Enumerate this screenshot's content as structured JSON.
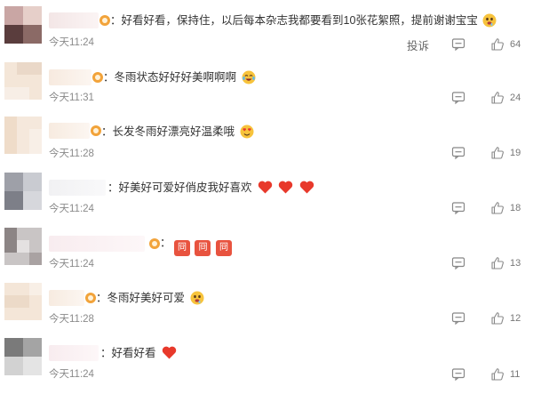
{
  "comments": [
    {
      "text": "：好看好看，保持住，以后每本杂志我都要看到10张花絮照，提前谢谢宝宝",
      "time": "今天11:24",
      "report": "投诉",
      "likes": "64",
      "icons": [
        "vip-badge-icon",
        "drooling-face-icon"
      ]
    },
    {
      "text": "：冬雨状态好好好美啊啊啊",
      "time": "今天11:31",
      "likes": "24",
      "icons": [
        "vip-badge-icon",
        "crying-laughing-face-icon"
      ]
    },
    {
      "text": "：长发冬雨好漂亮好温柔哦",
      "time": "今天11:28",
      "likes": "19",
      "icons": [
        "vip-badge-icon",
        "heart-eyes-face-icon"
      ]
    },
    {
      "text": "：好美好可爱好俏皮我好喜欢",
      "time": "今天11:24",
      "likes": "18",
      "icons": [
        "red-heart-icon",
        "red-heart-icon",
        "red-heart-icon"
      ]
    },
    {
      "text": "：",
      "stamps": [
        "冏",
        "冏",
        "冏"
      ],
      "time": "今天11:24",
      "likes": "13",
      "icons": [
        "vip-badge-icon",
        "sticker-icon"
      ]
    },
    {
      "text": "：冬雨好美好可爱",
      "time": "今天11:28",
      "likes": "12",
      "icons": [
        "vip-badge-icon",
        "drooling-face-icon"
      ]
    },
    {
      "text": "：好看好看",
      "time": "今天11:24",
      "likes": "11",
      "icons": [
        "red-heart-icon"
      ]
    }
  ],
  "colors": {
    "text": "#333333",
    "time": "#8a8a8a",
    "vip": "#f2a33a",
    "heart": "#e8392b"
  }
}
